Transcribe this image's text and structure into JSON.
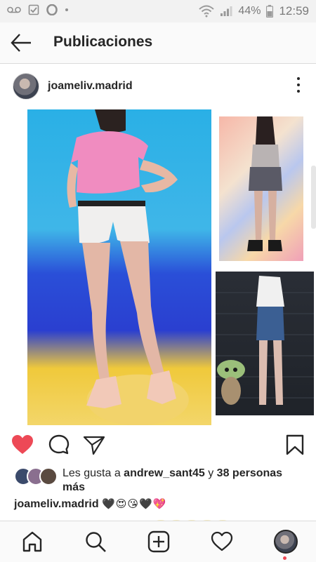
{
  "status_bar": {
    "battery_percent": "44%",
    "time": "12:59",
    "left_icons": [
      "voicemail-icon",
      "checkbox-icon",
      "opera-icon",
      "dot-icon"
    ],
    "right_icons": [
      "wifi-icon",
      "signal-icon",
      "battery-icon"
    ]
  },
  "header": {
    "title": "Publicaciones",
    "back_icon": "arrow-left-icon"
  },
  "post": {
    "username": "joameliv.madrid",
    "more_icon": "more-vertical-icon",
    "media": {
      "images": [
        "main-photo",
        "side-photo-top",
        "side-photo-bottom"
      ]
    },
    "actions": {
      "like_icon": "heart-filled-icon",
      "comment_icon": "comment-icon",
      "share_icon": "send-icon",
      "save_icon": "bookmark-icon",
      "liked": true,
      "like_color": "#ed4956"
    },
    "likes": {
      "prefix": "Les gusta a ",
      "user": "andrew_sant45",
      "middle": " y ",
      "others": "38 personas más"
    },
    "caption": {
      "username": "joameliv.madrid",
      "text": "🖤😍😘🖤💖"
    }
  },
  "bottom_nav": {
    "items": [
      "home-icon",
      "search-icon",
      "add-post-icon",
      "activity-heart-icon",
      "profile-avatar"
    ]
  }
}
